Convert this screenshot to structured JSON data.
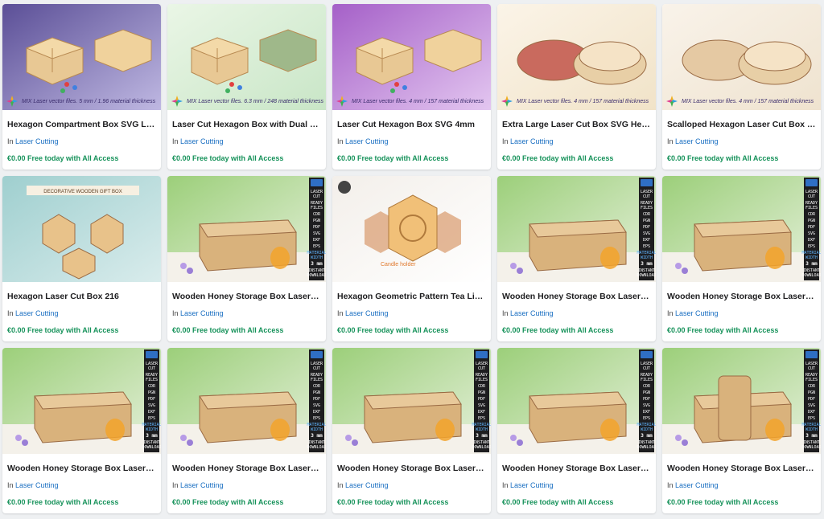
{
  "products": [
    {
      "title": "Hexagon Compartment Box SVG Laser Cut Files",
      "category_prefix": "In",
      "category": "Laser Cutting",
      "price": "€0.00 Free today with All Access",
      "badge": "MIX Laser vector files. 5 mm / 1.96 material thickness",
      "style": "hex-purple"
    },
    {
      "title": "Laser Cut Hexagon Box with Dual Divider",
      "category_prefix": "In",
      "category": "Laser Cutting",
      "price": "€0.00 Free today with All Access",
      "badge": "MIX Laser vector files. 6.3 mm / 248 material thickness",
      "style": "hex-green"
    },
    {
      "title": "Laser Cut Hexagon Box SVG 4mm",
      "category_prefix": "In",
      "category": "Laser Cutting",
      "price": "€0.00 Free today with All Access",
      "badge": "MIX Laser vector files. 4 mm / 157 material thickness",
      "style": "hex-violet"
    },
    {
      "title": "Extra Large Laser Cut Box SVG Hexagon",
      "category_prefix": "In",
      "category": "Laser Cutting",
      "price": "€0.00 Free today with All Access",
      "badge": "MIX Laser vector files. 4 mm / 157 material thickness",
      "style": "scallop-red"
    },
    {
      "title": "Scalloped Hexagon Laser Cut Box SVG",
      "category_prefix": "In",
      "category": "Laser Cutting",
      "price": "€0.00 Free today with All Access",
      "badge": "MIX Laser vector files. 4 mm / 157 material thickness",
      "style": "scallop-wood"
    },
    {
      "title": "Hexagon Laser Cut Box 216",
      "category_prefix": "In",
      "category": "Laser Cutting",
      "price": "€0.00 Free today with All Access",
      "badge": "DECORATIVE WOODEN GIFT BOX",
      "style": "gift-teal"
    },
    {
      "title": "Wooden Honey Storage Box Laser Cut File",
      "category_prefix": "In",
      "category": "Laser Cutting",
      "price": "€0.00 Free today with All Access",
      "badge": "",
      "style": "honey"
    },
    {
      "title": "Hexagon Geometric Pattern Tea Light Holder",
      "category_prefix": "In",
      "category": "Laser Cutting",
      "price": "€0.00 Free today with All Access",
      "badge": "Candle holder",
      "style": "candle"
    },
    {
      "title": "Wooden Honey Storage Box Laser Cut File",
      "category_prefix": "In",
      "category": "Laser Cutting",
      "price": "€0.00 Free today with All Access",
      "badge": "",
      "style": "honey"
    },
    {
      "title": "Wooden Honey Storage Box Laser Cut File",
      "category_prefix": "In",
      "category": "Laser Cutting",
      "price": "€0.00 Free today with All Access",
      "badge": "",
      "style": "honey"
    },
    {
      "title": "Wooden Honey Storage Box Laser Cut File",
      "category_prefix": "In",
      "category": "Laser Cutting",
      "price": "€0.00 Free today with All Access",
      "badge": "",
      "style": "honey"
    },
    {
      "title": "Wooden Honey Storage Box Laser Cut File",
      "category_prefix": "In",
      "category": "Laser Cutting",
      "price": "€0.00 Free today with All Access",
      "badge": "",
      "style": "honey"
    },
    {
      "title": "Wooden Honey Storage Box Laser Cut File",
      "category_prefix": "In",
      "category": "Laser Cutting",
      "price": "€0.00 Free today with All Access",
      "badge": "",
      "style": "honey"
    },
    {
      "title": "Wooden Honey Storage Box Laser Cut File",
      "category_prefix": "In",
      "category": "Laser Cutting",
      "price": "€0.00 Free today with All Access",
      "badge": "",
      "style": "honey"
    },
    {
      "title": "Wooden Honey Storage Box Laser Cut File",
      "category_prefix": "In",
      "category": "Laser Cutting",
      "price": "€0.00 Free today with All Access",
      "badge": "",
      "style": "honey-jar"
    }
  ],
  "side_panel": {
    "lines": [
      "LASER CUT",
      "READY FILES",
      "CDR",
      "PGN",
      "PDF",
      "SVG",
      "DXF",
      "EPS",
      "MATERIAL WIDTH",
      "3 mm",
      "INSTANT DOWNLOAD"
    ]
  },
  "colors": {
    "price": "#16925a",
    "link": "#1a6fc2",
    "wood": "#d9b27c"
  }
}
